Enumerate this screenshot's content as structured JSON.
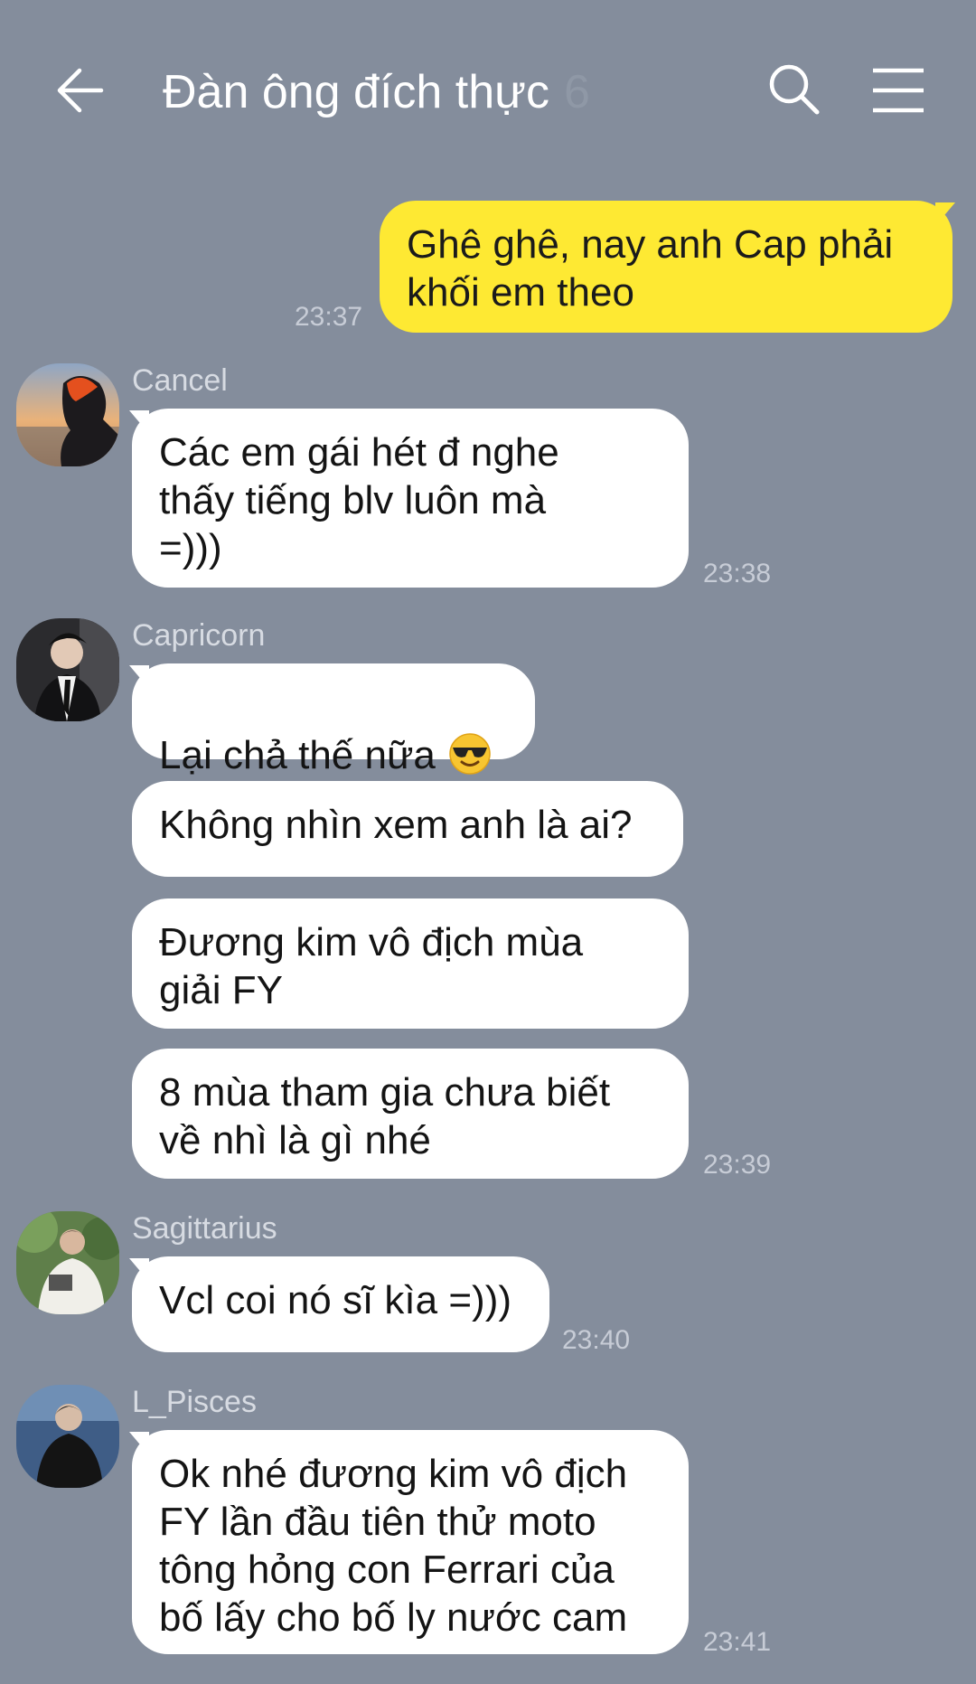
{
  "header": {
    "title": "Đàn ông đích thực",
    "member_count": "6"
  },
  "icons": {
    "back": "arrow-left-icon",
    "search": "search-icon",
    "menu": "hamburger-menu-icon"
  },
  "colors": {
    "background": "#848d9c",
    "outgoing_bubble": "#fee933",
    "incoming_bubble": "#ffffff"
  },
  "messages": {
    "m1": {
      "text": "Ghê ghê, nay anh Cap phải\nkhối em theo",
      "time": "23:37"
    },
    "cancel": {
      "sender": "Cancel",
      "m1": {
        "text": "Các em gái hét đ nghe\nthấy tiếng blv luôn mà\n=)))",
        "time": "23:38"
      }
    },
    "capricorn": {
      "sender": "Capricorn",
      "m1": {
        "text": "Lại chả thế nữa",
        "emoji": "sunglasses-emoji"
      },
      "m2": {
        "text": "Không nhìn xem anh là ai?"
      },
      "m3": {
        "text": "Đương kim vô địch mùa\ngiải FY"
      },
      "m4": {
        "text": "8 mùa tham gia chưa biết\nvề nhì là gì nhé",
        "time": "23:39"
      }
    },
    "sagittarius": {
      "sender": "Sagittarius",
      "m1": {
        "text": "Vcl coi nó sĩ kìa =)))",
        "time": "23:40"
      }
    },
    "lpisces": {
      "sender": "L_Pisces",
      "m1": {
        "text": "Ok nhé đương kim vô địch\nFY lần đầu tiên thử moto\ntông hỏng con Ferrari của\nbố lấy cho bố ly nước cam",
        "time": "23:41"
      }
    }
  }
}
